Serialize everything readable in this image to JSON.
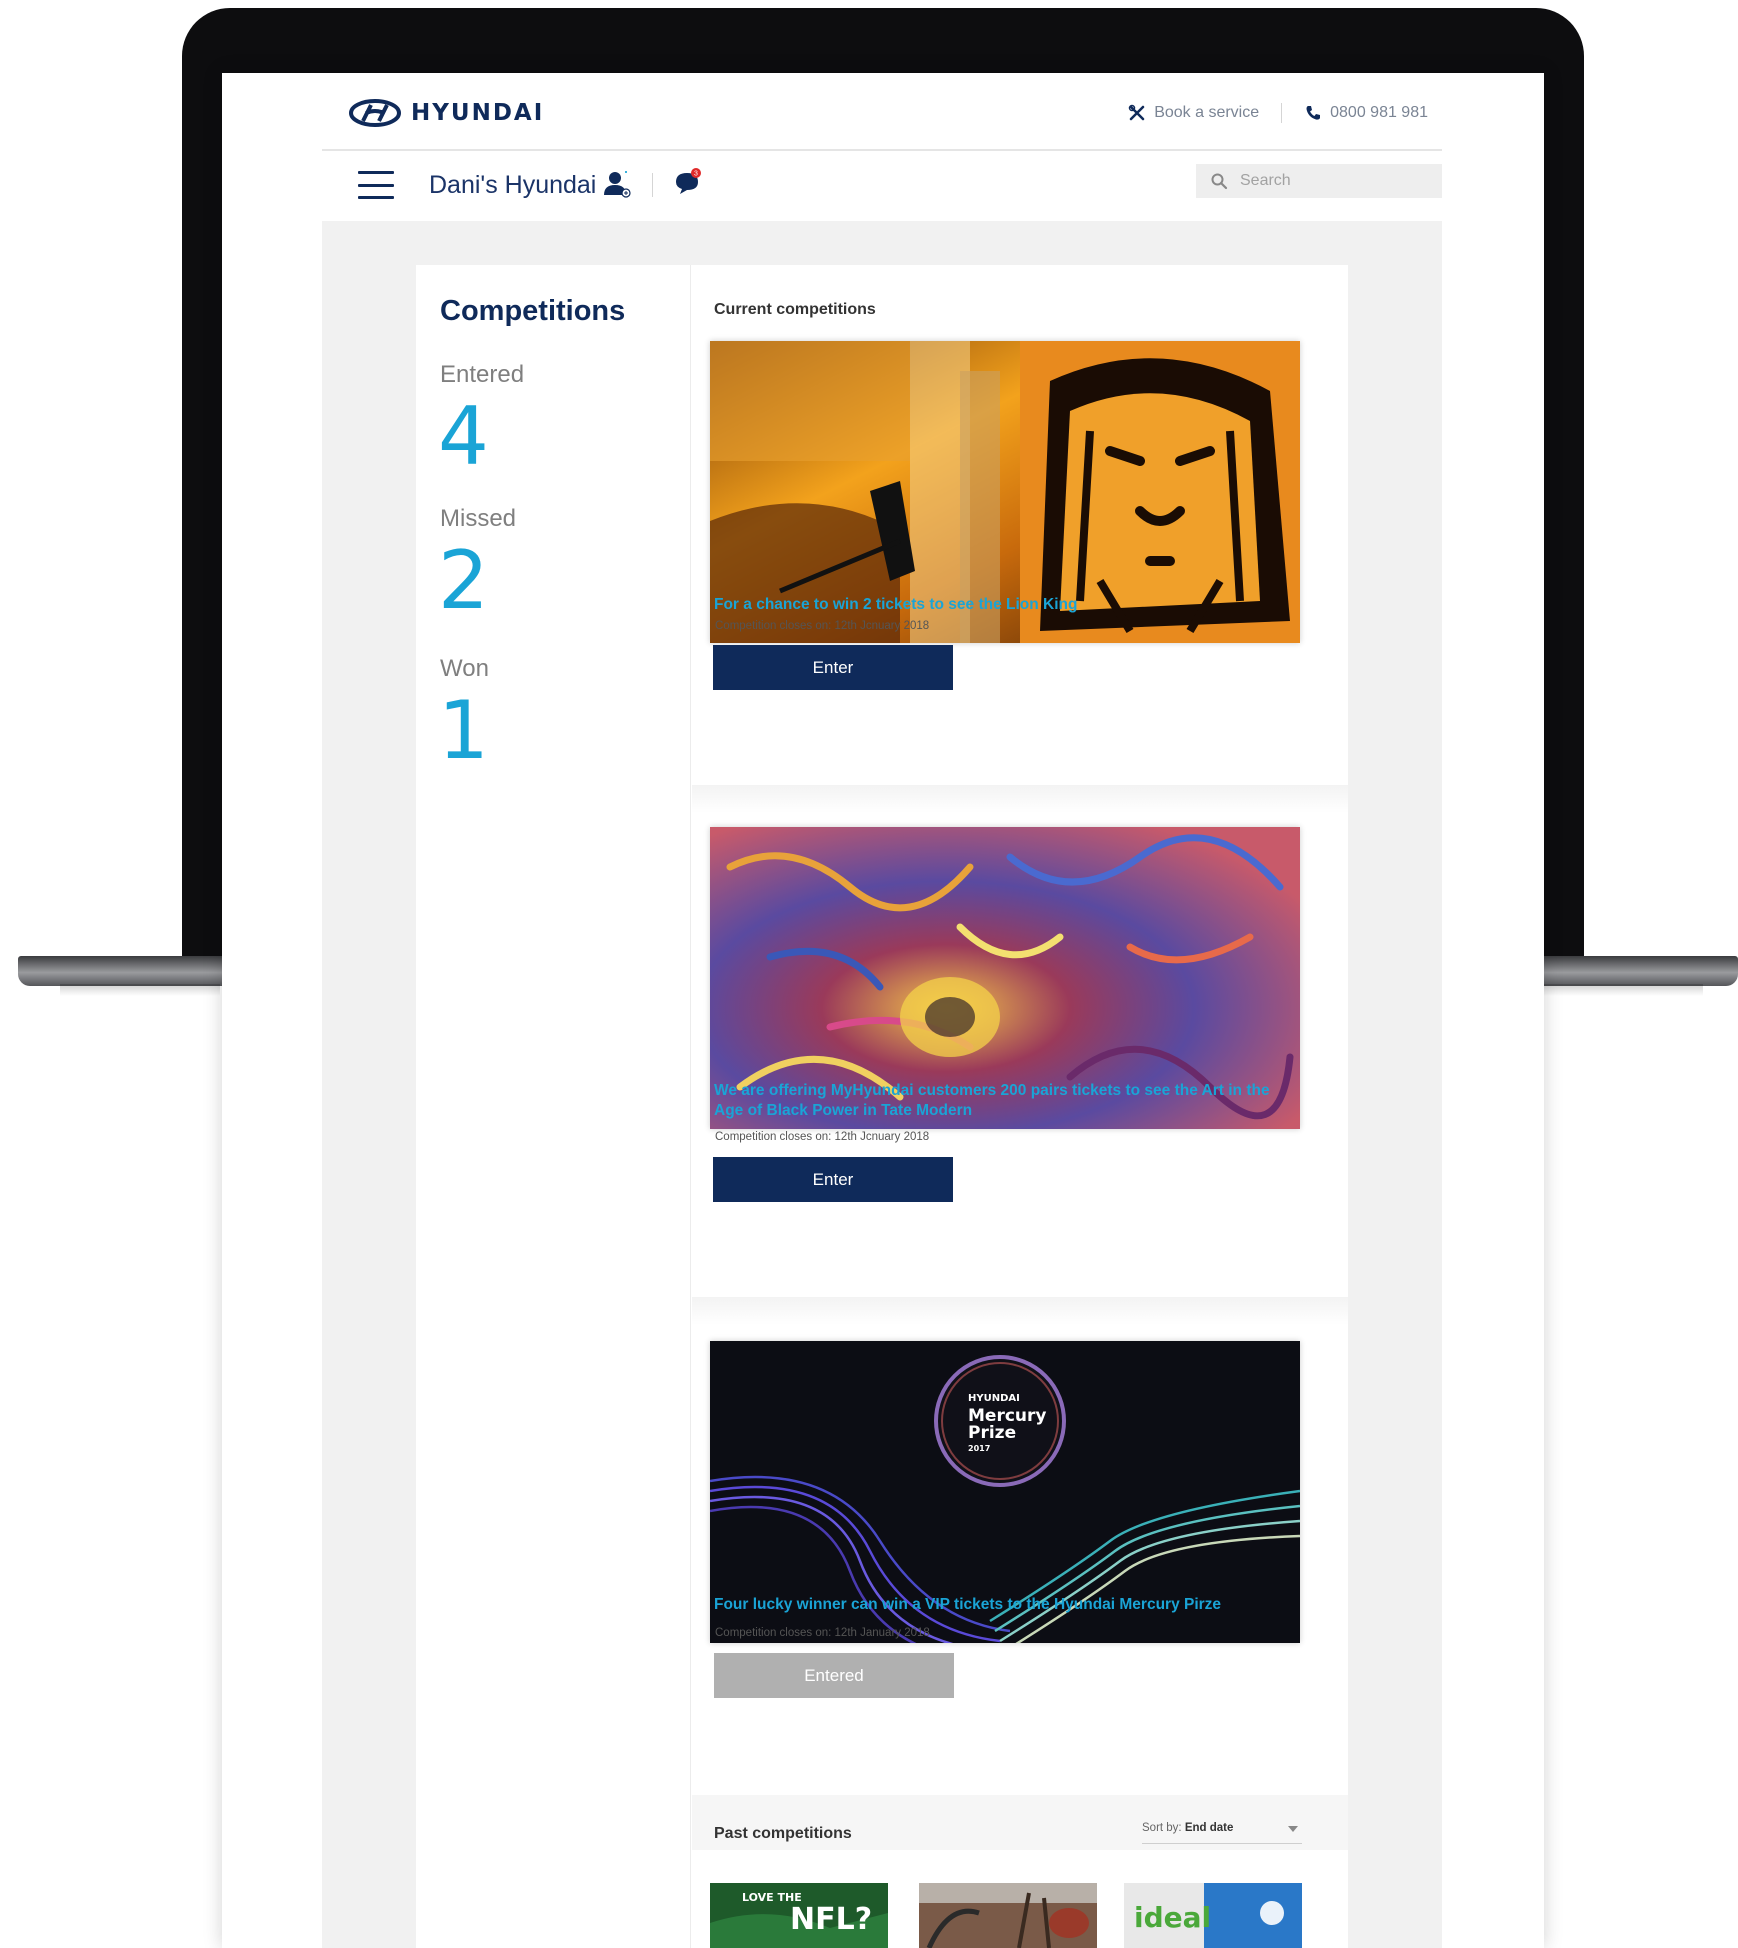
{
  "header": {
    "logo_text": "HYUNDAI",
    "book_service": "Book a service",
    "phone": "0800 981 981"
  },
  "nav": {
    "brand_name": "Dani's Hyundai",
    "search_placeholder": "Search"
  },
  "sidebar": {
    "title": "Competitions",
    "stats": [
      {
        "label": "Entered",
        "value": "4"
      },
      {
        "label": "Missed",
        "value": "2"
      },
      {
        "label": "Won",
        "value": "1"
      }
    ]
  },
  "main": {
    "current_label": "Current competitions",
    "competitions": [
      {
        "title": "For a chance to win 2 tickets to see the Lion King",
        "closes": "Competition closes on: 12th Jcnuary 2018",
        "button": "Enter",
        "image": "lion-king-theatre-image"
      },
      {
        "title": "We are offering MyHyundai customers 200 pairs tickets to see the Art in the Age of Black Power in Tate Modern",
        "closes": "Competition closes on: 12th Jcnuary 2018",
        "button": "Enter",
        "image": "abstract-artwork-image"
      },
      {
        "title": "Four lucky winner can win a VIP tickets to the Hyundai Mercury Pirze",
        "closes": "Competition closes on: 12th January 2018",
        "button": "Entered",
        "image": "mercury-prize-image",
        "image_badge": {
          "brand": "HYUNDAI",
          "line1": "Mercury",
          "line2": "Prize",
          "year": "2017"
        }
      }
    ],
    "past_label": "Past competitions",
    "sort": {
      "prefix": "Sort by:",
      "value": "End date"
    },
    "past_thumbs": [
      {
        "text_small": "LOVE THE",
        "text_big": "NFL?"
      },
      {
        "text_small": "",
        "text_big": ""
      },
      {
        "text_small": "",
        "text_big": "ideal"
      }
    ]
  },
  "colors": {
    "navy": "#0f2a5a",
    "accent_blue": "#1aa4d6",
    "disabled_grey": "#b0b0b0"
  }
}
